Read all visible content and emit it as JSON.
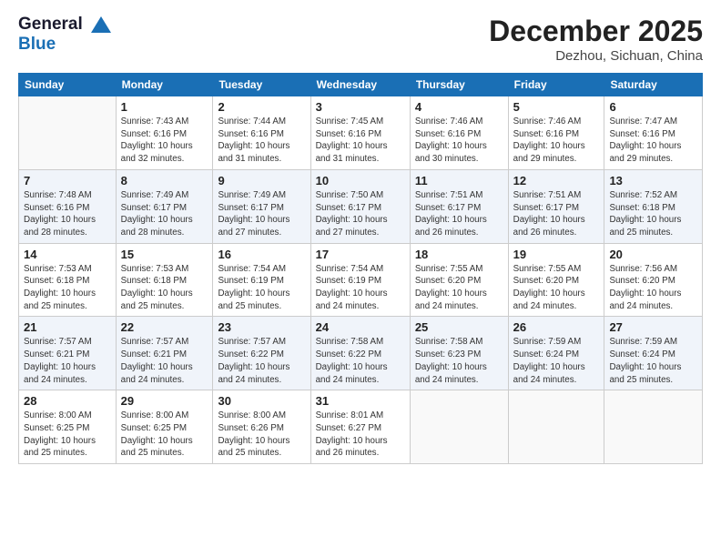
{
  "logo": {
    "line1": "General",
    "line2": "Blue"
  },
  "header": {
    "month": "December 2025",
    "location": "Dezhou, Sichuan, China"
  },
  "days_of_week": [
    "Sunday",
    "Monday",
    "Tuesday",
    "Wednesday",
    "Thursday",
    "Friday",
    "Saturday"
  ],
  "weeks": [
    [
      {
        "num": "",
        "info": ""
      },
      {
        "num": "1",
        "info": "Sunrise: 7:43 AM\nSunset: 6:16 PM\nDaylight: 10 hours\nand 32 minutes."
      },
      {
        "num": "2",
        "info": "Sunrise: 7:44 AM\nSunset: 6:16 PM\nDaylight: 10 hours\nand 31 minutes."
      },
      {
        "num": "3",
        "info": "Sunrise: 7:45 AM\nSunset: 6:16 PM\nDaylight: 10 hours\nand 31 minutes."
      },
      {
        "num": "4",
        "info": "Sunrise: 7:46 AM\nSunset: 6:16 PM\nDaylight: 10 hours\nand 30 minutes."
      },
      {
        "num": "5",
        "info": "Sunrise: 7:46 AM\nSunset: 6:16 PM\nDaylight: 10 hours\nand 29 minutes."
      },
      {
        "num": "6",
        "info": "Sunrise: 7:47 AM\nSunset: 6:16 PM\nDaylight: 10 hours\nand 29 minutes."
      }
    ],
    [
      {
        "num": "7",
        "info": "Sunrise: 7:48 AM\nSunset: 6:16 PM\nDaylight: 10 hours\nand 28 minutes."
      },
      {
        "num": "8",
        "info": "Sunrise: 7:49 AM\nSunset: 6:17 PM\nDaylight: 10 hours\nand 28 minutes."
      },
      {
        "num": "9",
        "info": "Sunrise: 7:49 AM\nSunset: 6:17 PM\nDaylight: 10 hours\nand 27 minutes."
      },
      {
        "num": "10",
        "info": "Sunrise: 7:50 AM\nSunset: 6:17 PM\nDaylight: 10 hours\nand 27 minutes."
      },
      {
        "num": "11",
        "info": "Sunrise: 7:51 AM\nSunset: 6:17 PM\nDaylight: 10 hours\nand 26 minutes."
      },
      {
        "num": "12",
        "info": "Sunrise: 7:51 AM\nSunset: 6:17 PM\nDaylight: 10 hours\nand 26 minutes."
      },
      {
        "num": "13",
        "info": "Sunrise: 7:52 AM\nSunset: 6:18 PM\nDaylight: 10 hours\nand 25 minutes."
      }
    ],
    [
      {
        "num": "14",
        "info": "Sunrise: 7:53 AM\nSunset: 6:18 PM\nDaylight: 10 hours\nand 25 minutes."
      },
      {
        "num": "15",
        "info": "Sunrise: 7:53 AM\nSunset: 6:18 PM\nDaylight: 10 hours\nand 25 minutes."
      },
      {
        "num": "16",
        "info": "Sunrise: 7:54 AM\nSunset: 6:19 PM\nDaylight: 10 hours\nand 25 minutes."
      },
      {
        "num": "17",
        "info": "Sunrise: 7:54 AM\nSunset: 6:19 PM\nDaylight: 10 hours\nand 24 minutes."
      },
      {
        "num": "18",
        "info": "Sunrise: 7:55 AM\nSunset: 6:20 PM\nDaylight: 10 hours\nand 24 minutes."
      },
      {
        "num": "19",
        "info": "Sunrise: 7:55 AM\nSunset: 6:20 PM\nDaylight: 10 hours\nand 24 minutes."
      },
      {
        "num": "20",
        "info": "Sunrise: 7:56 AM\nSunset: 6:20 PM\nDaylight: 10 hours\nand 24 minutes."
      }
    ],
    [
      {
        "num": "21",
        "info": "Sunrise: 7:57 AM\nSunset: 6:21 PM\nDaylight: 10 hours\nand 24 minutes."
      },
      {
        "num": "22",
        "info": "Sunrise: 7:57 AM\nSunset: 6:21 PM\nDaylight: 10 hours\nand 24 minutes."
      },
      {
        "num": "23",
        "info": "Sunrise: 7:57 AM\nSunset: 6:22 PM\nDaylight: 10 hours\nand 24 minutes."
      },
      {
        "num": "24",
        "info": "Sunrise: 7:58 AM\nSunset: 6:22 PM\nDaylight: 10 hours\nand 24 minutes."
      },
      {
        "num": "25",
        "info": "Sunrise: 7:58 AM\nSunset: 6:23 PM\nDaylight: 10 hours\nand 24 minutes."
      },
      {
        "num": "26",
        "info": "Sunrise: 7:59 AM\nSunset: 6:24 PM\nDaylight: 10 hours\nand 24 minutes."
      },
      {
        "num": "27",
        "info": "Sunrise: 7:59 AM\nSunset: 6:24 PM\nDaylight: 10 hours\nand 25 minutes."
      }
    ],
    [
      {
        "num": "28",
        "info": "Sunrise: 8:00 AM\nSunset: 6:25 PM\nDaylight: 10 hours\nand 25 minutes."
      },
      {
        "num": "29",
        "info": "Sunrise: 8:00 AM\nSunset: 6:25 PM\nDaylight: 10 hours\nand 25 minutes."
      },
      {
        "num": "30",
        "info": "Sunrise: 8:00 AM\nSunset: 6:26 PM\nDaylight: 10 hours\nand 25 minutes."
      },
      {
        "num": "31",
        "info": "Sunrise: 8:01 AM\nSunset: 6:27 PM\nDaylight: 10 hours\nand 26 minutes."
      },
      {
        "num": "",
        "info": ""
      },
      {
        "num": "",
        "info": ""
      },
      {
        "num": "",
        "info": ""
      }
    ]
  ]
}
